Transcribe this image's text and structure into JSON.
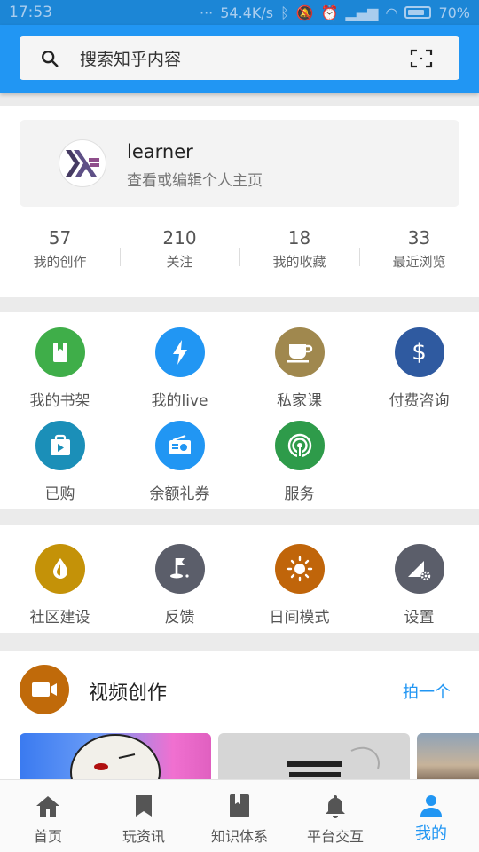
{
  "status_bar": {
    "time": "17:53",
    "network": "54.4K/s",
    "battery": "70%"
  },
  "search": {
    "placeholder": "搜索知乎内容"
  },
  "profile": {
    "name": "learner",
    "subtitle": "查看或编辑个人主页"
  },
  "stats": [
    {
      "value": "57",
      "label": "我的创作"
    },
    {
      "value": "210",
      "label": "关注"
    },
    {
      "value": "18",
      "label": "我的收藏"
    },
    {
      "value": "33",
      "label": "最近浏览"
    }
  ],
  "services": [
    {
      "label": "我的书架",
      "icon": "book-icon",
      "color": "#3fae49"
    },
    {
      "label": "我的live",
      "icon": "lightning-icon",
      "color": "#2196f3"
    },
    {
      "label": "私家课",
      "icon": "cup-icon",
      "color": "#a0884e"
    },
    {
      "label": "付费咨询",
      "icon": "dollar-icon",
      "color": "#2f5aa0"
    },
    {
      "label": "已购",
      "icon": "shopping-bag-icon",
      "color": "#1b8fb8"
    },
    {
      "label": "余额礼券",
      "icon": "radio-icon",
      "color": "#2196f3"
    },
    {
      "label": "服务",
      "icon": "signal-icon",
      "color": "#2e9b4a"
    }
  ],
  "tools": [
    {
      "label": "社区建设",
      "icon": "drop-icon",
      "color": "#c49208"
    },
    {
      "label": "反馈",
      "icon": "flag-icon",
      "color": "#5b5e6a"
    },
    {
      "label": "日间模式",
      "icon": "sun-icon",
      "color": "#c0650a"
    },
    {
      "label": "设置",
      "icon": "settings-icon",
      "color": "#5b5e6a"
    }
  ],
  "video": {
    "title": "视频创作",
    "action": "拍一个"
  },
  "nav": [
    {
      "label": "首页",
      "icon": "home-icon"
    },
    {
      "label": "玩资讯",
      "icon": "bookmark-icon"
    },
    {
      "label": "知识体系",
      "icon": "book-icon"
    },
    {
      "label": "平台交互",
      "icon": "bell-icon"
    },
    {
      "label": "我的",
      "icon": "person-icon"
    }
  ],
  "colors": {
    "primary": "#2196f3",
    "status_bar": "#1c86d6"
  }
}
